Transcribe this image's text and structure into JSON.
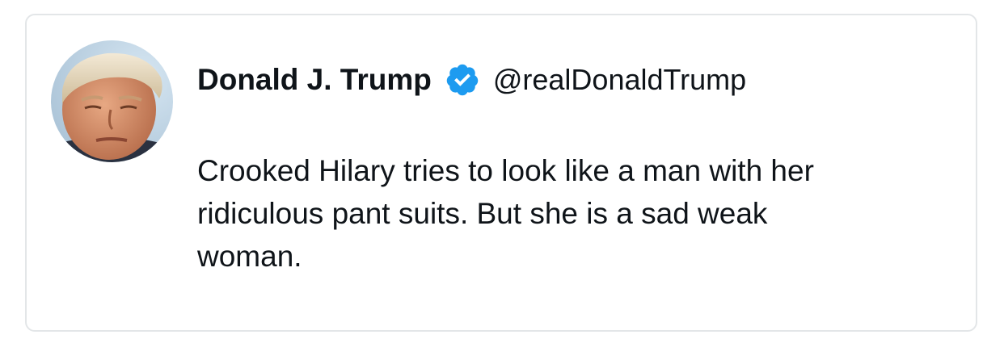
{
  "tweet": {
    "author": {
      "display_name": "Donald J. Trump",
      "handle": "@realDonaldTrump",
      "verified": true,
      "avatar_icon": "profile-photo"
    },
    "text": "Crooked Hilary tries to look like a man with her\nridiculous pant suits. But she is a sad weak\nwoman."
  },
  "colors": {
    "verified_badge": "#1d9bf0",
    "card_border": "#e3e6e8",
    "text": "#0f1419"
  }
}
